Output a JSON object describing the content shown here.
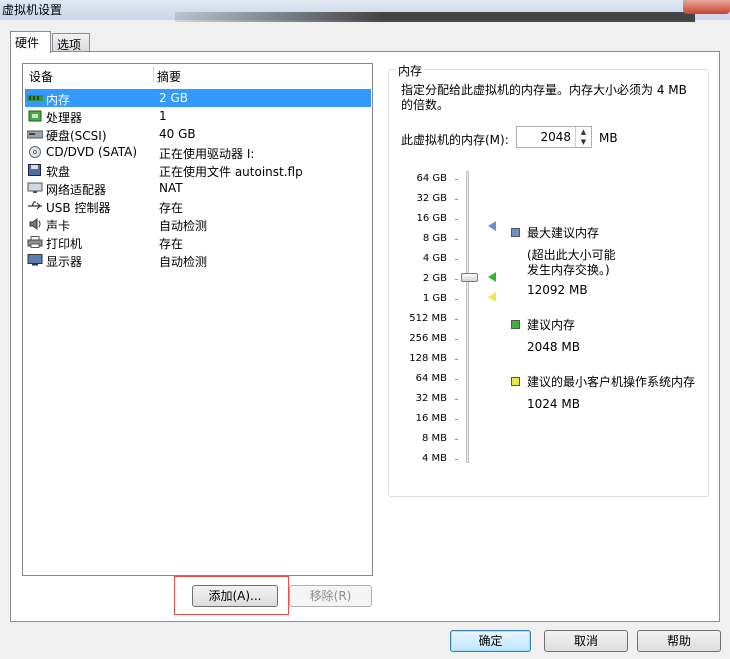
{
  "window": {
    "title": "虚拟机设置"
  },
  "tabs": [
    {
      "label": "硬件"
    },
    {
      "label": "选项"
    }
  ],
  "devices": {
    "col_device": "设备",
    "col_summary": "摘要",
    "items": [
      {
        "icon": "memory-icon",
        "name": "内存",
        "summary": "2 GB"
      },
      {
        "icon": "processor-icon",
        "name": "处理器",
        "summary": "1"
      },
      {
        "icon": "hard-disk-icon",
        "name": "硬盘(SCSI)",
        "summary": "40 GB"
      },
      {
        "icon": "cd-dvd-icon",
        "name": "CD/DVD (SATA)",
        "summary": "正在使用驱动器 I:"
      },
      {
        "icon": "floppy-icon",
        "name": "软盘",
        "summary": "正在使用文件 autoinst.flp"
      },
      {
        "icon": "network-adapter-icon",
        "name": "网络适配器",
        "summary": "NAT"
      },
      {
        "icon": "usb-icon",
        "name": "USB 控制器",
        "summary": "存在"
      },
      {
        "icon": "sound-card-icon",
        "name": "声卡",
        "summary": "自动检测"
      },
      {
        "icon": "printer-icon",
        "name": "打印机",
        "summary": "存在"
      },
      {
        "icon": "display-icon",
        "name": "显示器",
        "summary": "自动检测"
      }
    ]
  },
  "buttons": {
    "add": "添加(A)...",
    "remove": "移除(R)",
    "ok": "确定",
    "cancel": "取消",
    "help": "帮助"
  },
  "memory": {
    "group_label": "内存",
    "description": "指定分配给此虚拟机的内存量。内存大小必须为 4 MB 的倍数。",
    "field_label": "此虚拟机的内存(M):",
    "value": "2048",
    "unit": "MB",
    "scale_labels": [
      "64 GB",
      "32 GB",
      "16 GB",
      "8 GB",
      "4 GB",
      "2 GB",
      "1 GB",
      "512 MB",
      "256 MB",
      "128 MB",
      "64 MB",
      "32 MB",
      "16 MB",
      "8 MB",
      "4 MB"
    ],
    "legend": {
      "max_title": "最大建议内存",
      "max_note_1": "(超出此大小可能",
      "max_note_2": "发生内存交换。)",
      "max_value": "12092 MB",
      "rec_title": "建议内存",
      "rec_value": "2048 MB",
      "min_title": "建议的最小客户机操作系统内存",
      "min_value": "1024 MB"
    },
    "colors": {
      "max": "#6f8fc8",
      "recommended": "#3ab33a",
      "minimum": "#e8e84a"
    }
  }
}
